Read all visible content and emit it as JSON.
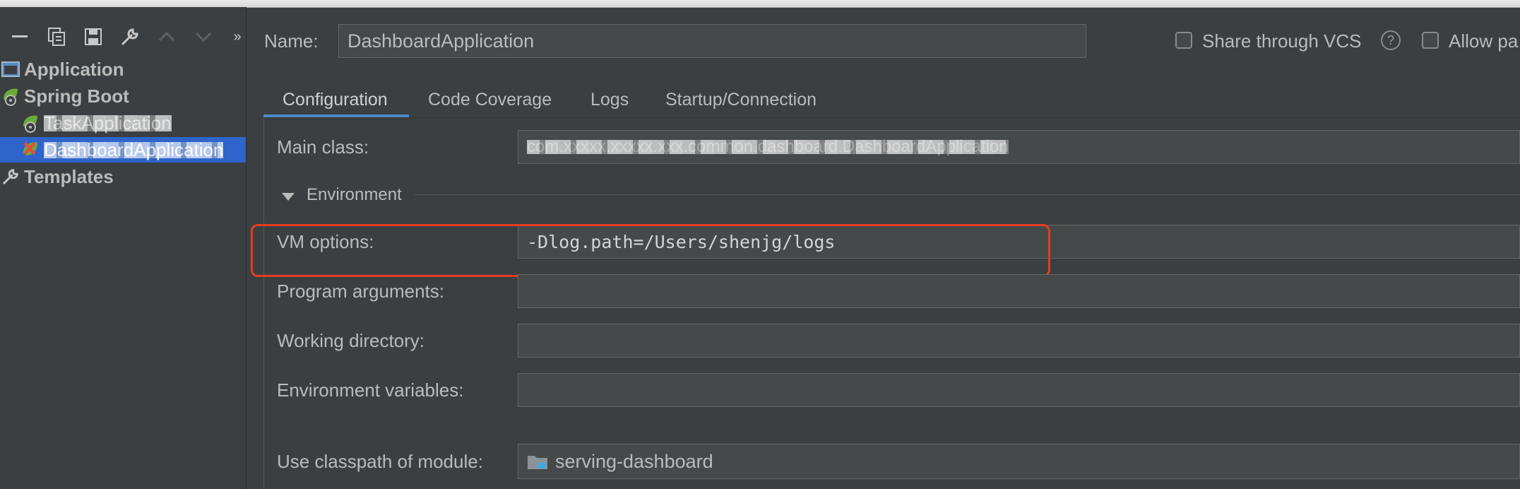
{
  "sidebar": {
    "toolbar_icons": [
      "minus-icon",
      "copy-icon",
      "save-icon",
      "wrench-icon",
      "arrow-up-icon",
      "arrow-down-icon",
      "more-icon"
    ],
    "tree": [
      {
        "label": "Application",
        "icon": "application-icon"
      },
      {
        "label": "Spring Boot",
        "icon": "spring-boot-icon"
      },
      {
        "label": "TaskApplication",
        "icon": "spring-boot-run-icon",
        "redacted": true
      },
      {
        "label": "DashboardApplication",
        "icon": "spring-boot-error-icon",
        "redacted": true,
        "selected": true
      },
      {
        "label": "Templates",
        "icon": "wrench-icon"
      }
    ]
  },
  "header": {
    "name_label": "Name:",
    "name_value": "DashboardApplication",
    "share_vcs_label": "Share through VCS",
    "help_symbol": "?",
    "allow_label": "Allow pa"
  },
  "tabs": [
    {
      "label": "Configuration",
      "active": true
    },
    {
      "label": "Code Coverage"
    },
    {
      "label": "Logs"
    },
    {
      "label": "Startup/Connection"
    }
  ],
  "form": {
    "main_class_label": "Main class:",
    "main_class_value": "com.xxxxx.xxxxx.xxx.common.dashboard.DashboardApplication",
    "environment_label": "Environment",
    "vm_options_label": "VM options:",
    "vm_options_value": "-Dlog.path=/Users/shenjg/logs",
    "program_args_label": "Program arguments:",
    "working_dir_label": "Working directory:",
    "env_vars_label": "Environment variables:",
    "classpath_label": "Use classpath of module:",
    "classpath_value": "serving-dashboard"
  },
  "colors": {
    "background": "#3c3f41",
    "selection": "#2f65ca",
    "tab_underline": "#4a88c7",
    "highlight_box": "#e53d1f"
  }
}
